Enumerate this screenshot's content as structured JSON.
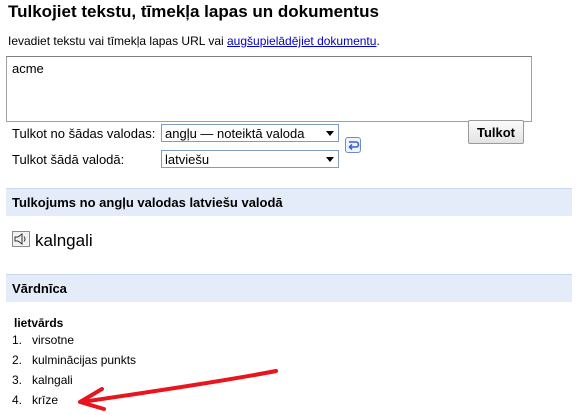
{
  "header": {
    "title": "Tulkojiet tekstu, tīmekļa lapas un dokumentus"
  },
  "intro": {
    "prefix": "Ievadiet tekstu vai tīmekļa lapas URL vai ",
    "link": "augšupielādējiet dokumentu",
    "suffix": "."
  },
  "source": {
    "text": "acme"
  },
  "form": {
    "from_label": "Tulkot no šādas valodas:",
    "from_value": "angļu — noteiktā valoda",
    "to_label": "Tulkot šādā valodā:",
    "to_value": "latviešu",
    "translate_button": "Tulkot"
  },
  "translation": {
    "heading": "Tulkojums no angļu valodas latviešu valodā",
    "result": "kalngali"
  },
  "dictionary": {
    "heading": "Vārdnīca",
    "part_of_speech": "lietvārds",
    "entries": [
      {
        "num": "1.",
        "word": "virsotne"
      },
      {
        "num": "2.",
        "word": "kulminācijas punkts"
      },
      {
        "num": "3.",
        "word": "kalngali"
      },
      {
        "num": "4.",
        "word": "krīze"
      }
    ]
  },
  "colors": {
    "section_bar": "#e5ecf9",
    "link": "#0000cc",
    "annotation_arrow": "#e8141e"
  },
  "icons": {
    "speaker": "speaker-icon",
    "swap": "swap-languages-icon",
    "dropdown": "chevron-down-icon"
  }
}
